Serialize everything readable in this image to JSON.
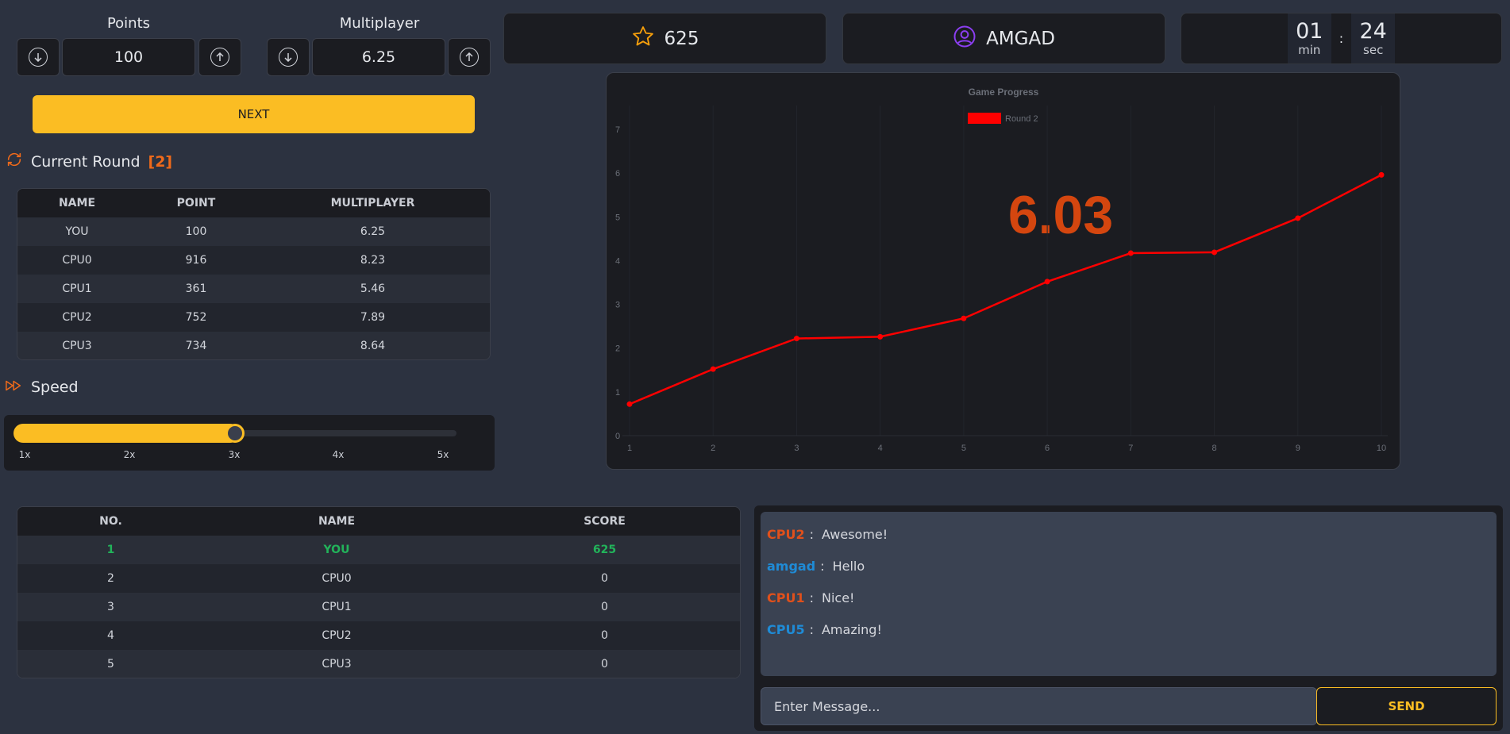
{
  "controls": {
    "points": {
      "label": "Points",
      "value": "100"
    },
    "multiplier": {
      "label": "Multiplayer",
      "value": "6.25"
    },
    "next_label": "NEXT"
  },
  "current_round": {
    "title": "Current Round",
    "number": "[2]"
  },
  "round_table": {
    "headers": [
      "NAME",
      "POINT",
      "MULTIPLAYER"
    ],
    "rows": [
      [
        "YOU",
        "100",
        "6.25"
      ],
      [
        "CPU0",
        "916",
        "8.23"
      ],
      [
        "CPU1",
        "361",
        "5.46"
      ],
      [
        "CPU2",
        "752",
        "7.89"
      ],
      [
        "CPU3",
        "734",
        "8.64"
      ]
    ]
  },
  "speed": {
    "title": "Speed",
    "ticks": [
      "1x",
      "2x",
      "3x",
      "4x",
      "5x"
    ],
    "level": 0.5,
    "accent": "#fbbd23"
  },
  "stats": {
    "score": "625",
    "username": "AMGAD",
    "timer": {
      "min": "01",
      "sep": ":",
      "sec": "24",
      "min_unit": "min",
      "sec_unit": "sec"
    }
  },
  "chart_data": {
    "type": "line",
    "title": "Game Progress",
    "x": [
      1,
      2,
      3,
      4,
      5,
      6,
      7,
      8,
      9,
      10
    ],
    "series": [
      {
        "name": "Round 2",
        "color": "#ff0000",
        "values": [
          0.72,
          1.52,
          2.22,
          2.26,
          2.68,
          3.52,
          4.17,
          4.19,
          4.97,
          5.96
        ]
      }
    ],
    "ylim": [
      0,
      7
    ],
    "y_ticks": [
      0,
      1,
      2,
      3,
      4,
      5,
      6,
      7
    ],
    "legend": "top-center",
    "grid": false,
    "overlay_value": "6.03",
    "overlay_color": "#d4460f"
  },
  "leaderboard": {
    "headers": [
      "NO.",
      "NAME",
      "SCORE"
    ],
    "rows": [
      [
        "1",
        "YOU",
        "625"
      ],
      [
        "2",
        "CPU0",
        "0"
      ],
      [
        "3",
        "CPU1",
        "0"
      ],
      [
        "4",
        "CPU2",
        "0"
      ],
      [
        "5",
        "CPU3",
        "0"
      ]
    ],
    "highlight_color": "#22b35a"
  },
  "chat": {
    "messages": [
      {
        "name": "CPU2",
        "sep": ":",
        "text": "Awesome!",
        "color": "#e0501b"
      },
      {
        "name": "amgad",
        "sep": ":",
        "text": "Hello",
        "color": "#1f8bd6"
      },
      {
        "name": "CPU1",
        "sep": ":",
        "text": "Nice!",
        "color": "#e0501b"
      },
      {
        "name": "CPU5",
        "sep": ":",
        "text": "Amazing!",
        "color": "#1f8bd6"
      }
    ],
    "placeholder": "Enter Message...",
    "send_label": "SEND"
  },
  "icons": {
    "down": "arrow-down-circle-icon",
    "up": "arrow-up-circle-icon",
    "round": "refresh-icon",
    "speed": "fast-forward-icon",
    "score": "star-icon",
    "user": "user-circle-icon"
  }
}
